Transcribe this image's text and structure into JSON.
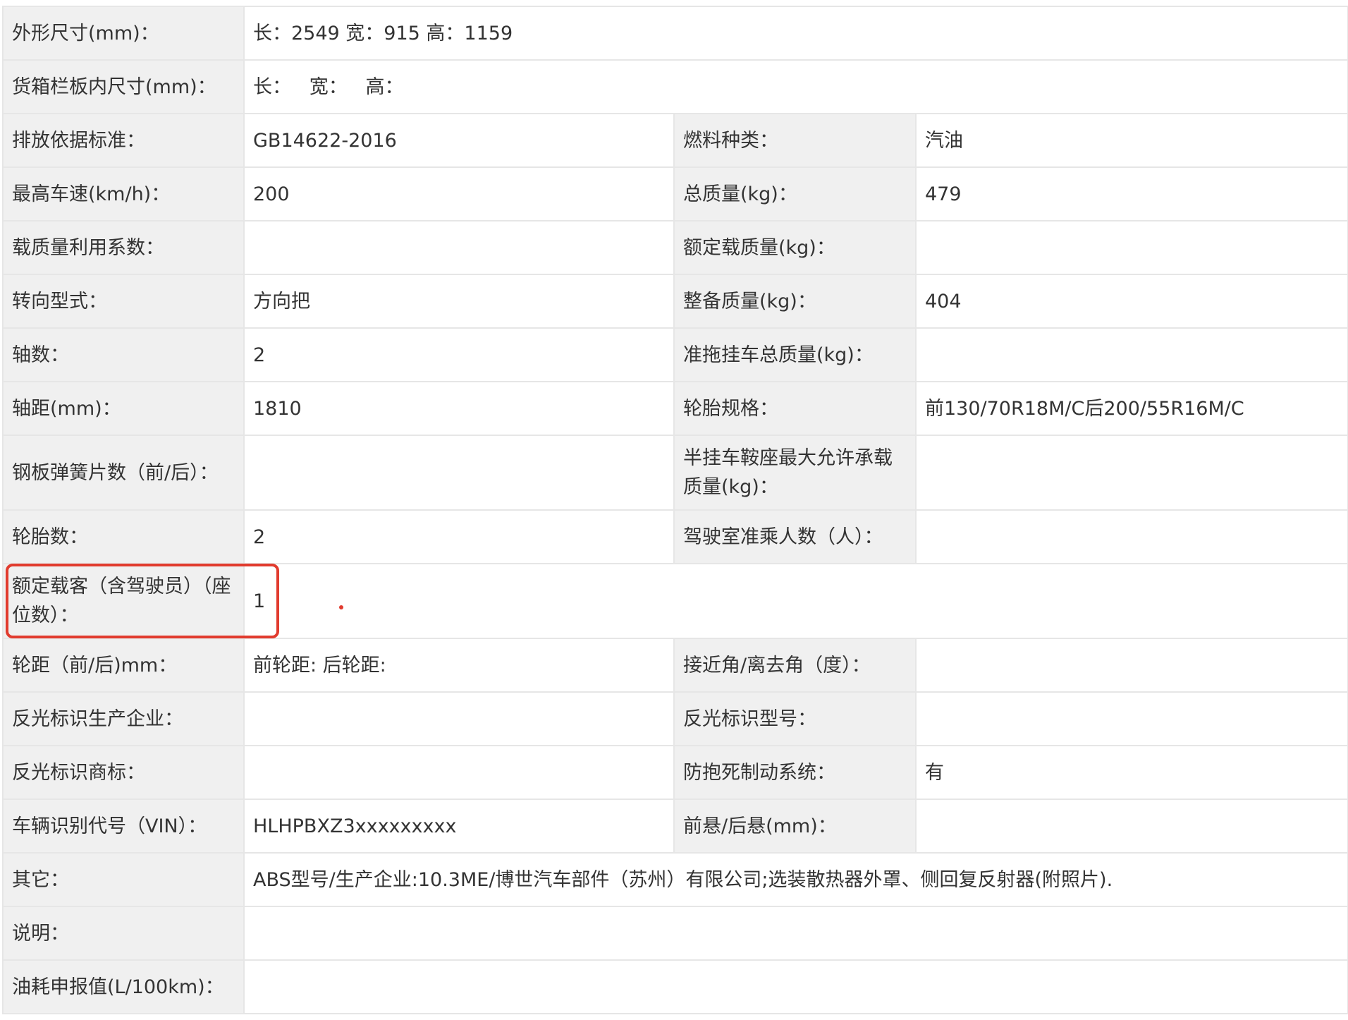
{
  "rows": [
    {
      "kind": "full",
      "label": "外形尺寸(mm)：",
      "value": "长：2549 宽：915 高：1159"
    },
    {
      "kind": "full",
      "label": "货箱栏板内尺寸(mm)：",
      "value": "长：   宽：   高："
    },
    {
      "kind": "pair",
      "label1": "排放依据标准：",
      "value1": "GB14622-2016",
      "label2": "燃料种类：",
      "value2": "汽油"
    },
    {
      "kind": "pair",
      "label1": "最高车速(km/h)：",
      "value1": "200",
      "label2": "总质量(kg)：",
      "value2": "479"
    },
    {
      "kind": "pair",
      "label1": "载质量利用系数：",
      "value1": "",
      "label2": "额定载质量(kg)：",
      "value2": ""
    },
    {
      "kind": "pair",
      "label1": "转向型式：",
      "value1": "方向把",
      "label2": "整备质量(kg)：",
      "value2": "404"
    },
    {
      "kind": "pair",
      "label1": "轴数：",
      "value1": "2",
      "label2": "准拖挂车总质量(kg)：",
      "value2": ""
    },
    {
      "kind": "pair",
      "label1": "轴距(mm)：",
      "value1": "1810",
      "label2": "轮胎规格：",
      "value2": "前130/70R18M/C后200/55R16M/C"
    },
    {
      "kind": "pair",
      "tall": true,
      "label1": "钢板弹簧片数（前/后）：",
      "value1": "",
      "label2": "半挂车鞍座最大允许承载质量(kg)：",
      "value2": ""
    },
    {
      "kind": "pair",
      "label1": "轮胎数：",
      "value1": "2",
      "label2": "驾驶室准乘人数（人）：",
      "value2": ""
    },
    {
      "kind": "full",
      "tall": true,
      "label": "额定载客（含驾驶员）（座位数）：",
      "value": "1"
    },
    {
      "kind": "pair",
      "label1": "轮距（前/后)mm：",
      "value1": "前轮距: 后轮距:",
      "label2": "接近角/离去角（度）：",
      "value2": ""
    },
    {
      "kind": "pair",
      "label1": "反光标识生产企业：",
      "value1": "",
      "label2": "反光标识型号：",
      "value2": ""
    },
    {
      "kind": "pair",
      "label1": "反光标识商标：",
      "value1": "",
      "label2": "防抱死制动系统：",
      "value2": "有"
    },
    {
      "kind": "pair",
      "label1": "车辆识别代号（VIN）：",
      "value1": "HLHPBXZ3xxxxxxxxx",
      "label2": "前悬/后悬(mm)：",
      "value2": ""
    },
    {
      "kind": "full",
      "label": "其它：",
      "value": "ABS型号/生产企业:10.3ME/博世汽车部件（苏州）有限公司;选装散热器外罩、侧回复反射器(附照片)."
    },
    {
      "kind": "full",
      "label": "说明：",
      "value": ""
    },
    {
      "kind": "full",
      "label": "油耗申报值(L/100km)：",
      "value": ""
    }
  ],
  "highlight": {
    "color": "#e13b2e",
    "target": "额定载客（含驾驶员）（座位数）："
  }
}
